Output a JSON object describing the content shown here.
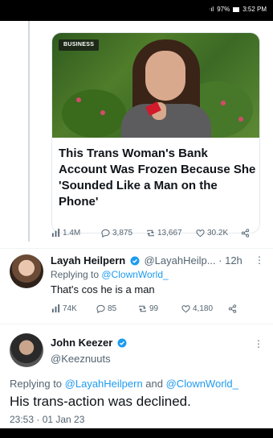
{
  "status_bar": {
    "signal": "ᐧıl",
    "battery_percent": "97%",
    "time": "3:52 PM"
  },
  "article": {
    "badge": "BUSINESS",
    "headline": "This Trans Woman's Bank Account Was Frozen Because She 'Sounded Like a Man on the Phone'"
  },
  "tweet1_stats": {
    "views": "1.4M",
    "replies": "3,875",
    "retweets": "13,667",
    "likes": "30.2K"
  },
  "tweet2": {
    "name": "Layah Heilpern",
    "handle": "@LayahHeilp...",
    "time": "· 12h",
    "replying_prefix": "Replying to ",
    "replying_to": "@ClownWorld_",
    "text": "That's cos he is a man",
    "stats": {
      "views": "74K",
      "replies": "85",
      "retweets": "99",
      "likes": "4,180"
    }
  },
  "tweet3": {
    "name": "John Keezer",
    "handle": "@Keeznuuts",
    "replying_prefix": "Replying to ",
    "replying_to_1": "@LayahHeilpern",
    "replying_and": " and ",
    "replying_to_2": "@ClownWorld_",
    "text": "His trans-action was declined.",
    "timestamp": "23:53 · 01 Jan 23"
  },
  "colors": {
    "accent": "#1d9bf0",
    "muted": "#536471",
    "text": "#0f1419"
  }
}
